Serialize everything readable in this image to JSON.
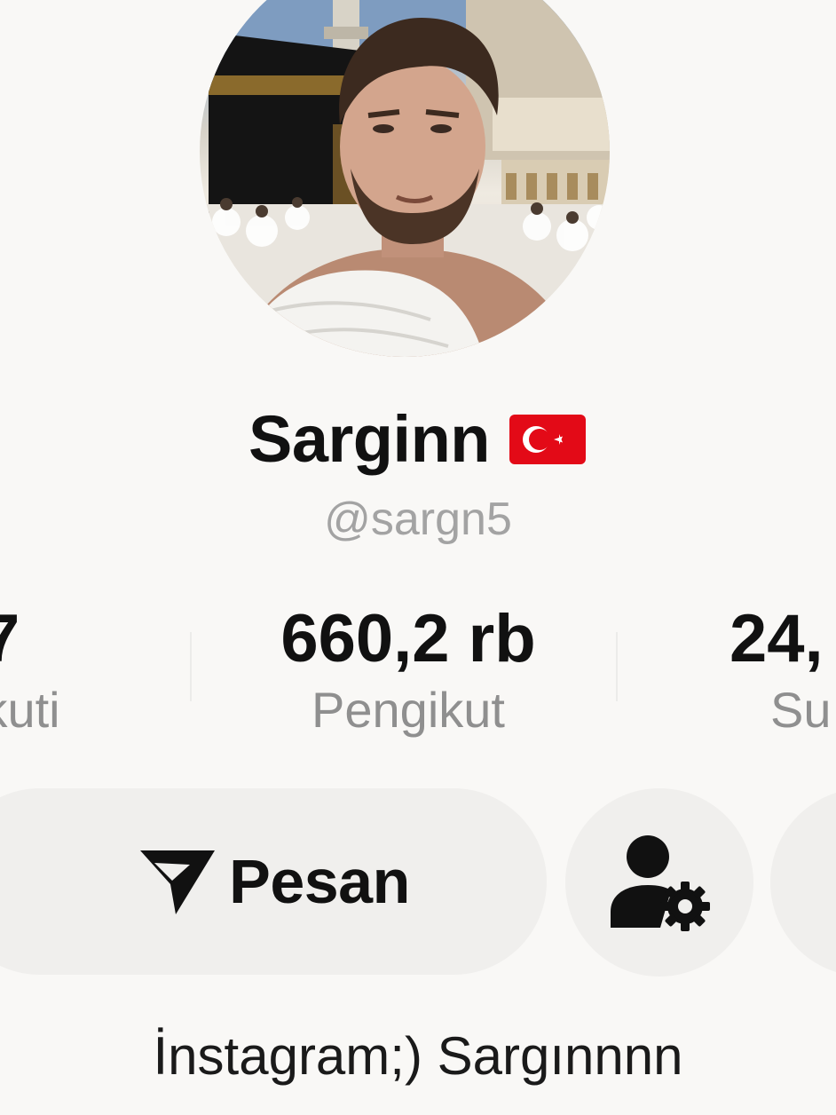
{
  "profile": {
    "display_name": "Sarginn",
    "flag_icon": "turkey-flag-icon",
    "username": "@sargn5",
    "avatar_icon": "profile-photo"
  },
  "stats": {
    "following": {
      "value": "7",
      "label": "ikuti"
    },
    "followers": {
      "value": "660,2 rb",
      "label": "Pengikut"
    },
    "likes": {
      "value": "24,",
      "label": "Su"
    }
  },
  "actions": {
    "message_label": "Pesan",
    "message_icon": "send-icon",
    "profile_options_icon": "user-gear-icon"
  },
  "bio": {
    "line1": "İnstagram;) Sargınnnn",
    "line2": ""
  },
  "colors": {
    "background": "#f9f8f6",
    "button_bg": "#f0efed",
    "text_primary": "#111111",
    "text_secondary": "#8f8f8f",
    "flag_red": "#e30a17"
  }
}
